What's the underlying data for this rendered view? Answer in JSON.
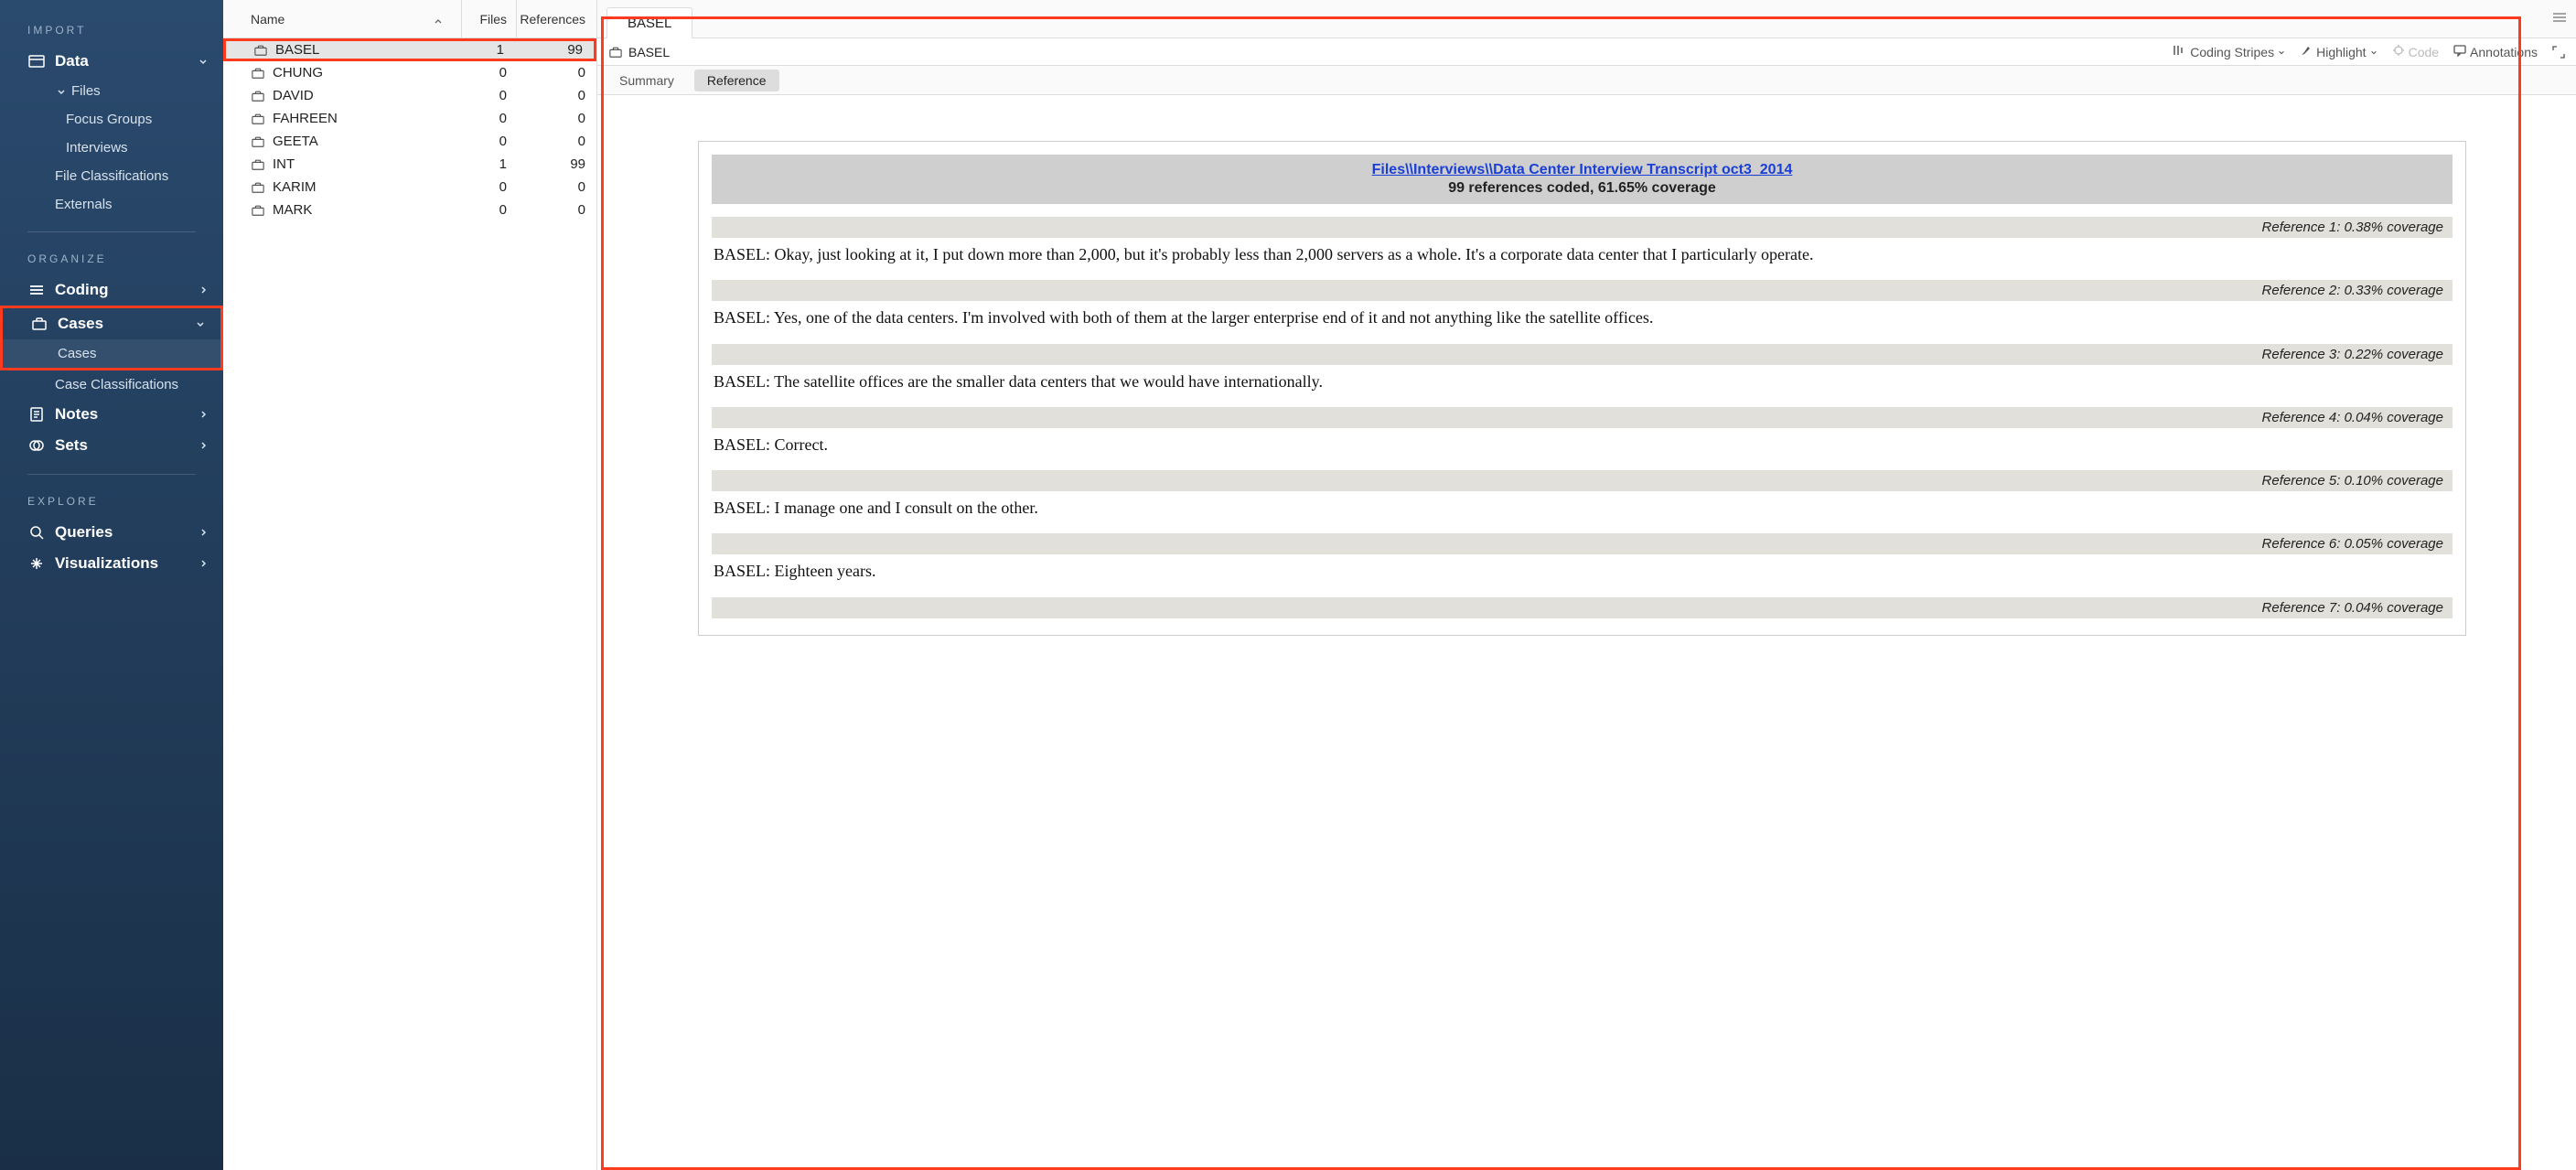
{
  "sidebar": {
    "sections": {
      "import": "IMPORT",
      "organize": "ORGANIZE",
      "explore": "EXPLORE"
    },
    "data": {
      "label": "Data",
      "files": "Files",
      "focus_groups": "Focus Groups",
      "interviews": "Interviews",
      "file_class": "File Classifications",
      "externals": "Externals"
    },
    "coding": "Coding",
    "cases": {
      "label": "Cases",
      "sub_cases": "Cases",
      "case_class": "Case Classifications"
    },
    "notes": "Notes",
    "sets": "Sets",
    "queries": "Queries",
    "visualizations": "Visualizations"
  },
  "list": {
    "headers": {
      "name": "Name",
      "files": "Files",
      "refs": "References"
    },
    "rows": [
      {
        "name": "BASEL",
        "files": "1",
        "refs": "99",
        "selected": true
      },
      {
        "name": "CHUNG",
        "files": "0",
        "refs": "0"
      },
      {
        "name": "DAVID",
        "files": "0",
        "refs": "0"
      },
      {
        "name": "FAHREEN",
        "files": "0",
        "refs": "0"
      },
      {
        "name": "GEETA",
        "files": "0",
        "refs": "0"
      },
      {
        "name": "INT",
        "files": "1",
        "refs": "99"
      },
      {
        "name": "KARIM",
        "files": "0",
        "refs": "0"
      },
      {
        "name": "MARK",
        "files": "0",
        "refs": "0"
      }
    ]
  },
  "detail": {
    "tab": "BASEL",
    "bar_title": "BASEL",
    "tools": {
      "coding_stripes": "Coding Stripes",
      "highlight": "Highlight",
      "code": "Code",
      "annotations": "Annotations"
    },
    "subtabs": {
      "summary": "Summary",
      "reference": "Reference"
    },
    "doc": {
      "link": "Files\\\\Interviews\\\\Data Center Interview Transcript oct3_2014",
      "sub": "99 references coded, 61.65% coverage",
      "refs": [
        {
          "label": "Reference 1: 0.38% coverage",
          "text": "BASEL:  Okay, just looking at it, I put down more than 2,000, but it's probably less than 2,000 servers as a whole. It's a corporate data center that I particularly operate."
        },
        {
          "label": "Reference 2: 0.33% coverage",
          "text": "BASEL:  Yes, one of the data centers. I'm involved with both of them at the larger enterprise end of it and not anything like the satellite offices."
        },
        {
          "label": "Reference 3: 0.22% coverage",
          "text": "BASEL:  The satellite offices are the smaller data centers that we would have internationally."
        },
        {
          "label": "Reference 4: 0.04% coverage",
          "text": "BASEL:  Correct."
        },
        {
          "label": "Reference 5: 0.10% coverage",
          "text": "BASEL:  I manage one and I consult on the other."
        },
        {
          "label": "Reference 6: 0.05% coverage",
          "text": "BASEL:  Eighteen years."
        },
        {
          "label": "Reference 7: 0.04% coverage",
          "text": ""
        }
      ]
    }
  }
}
